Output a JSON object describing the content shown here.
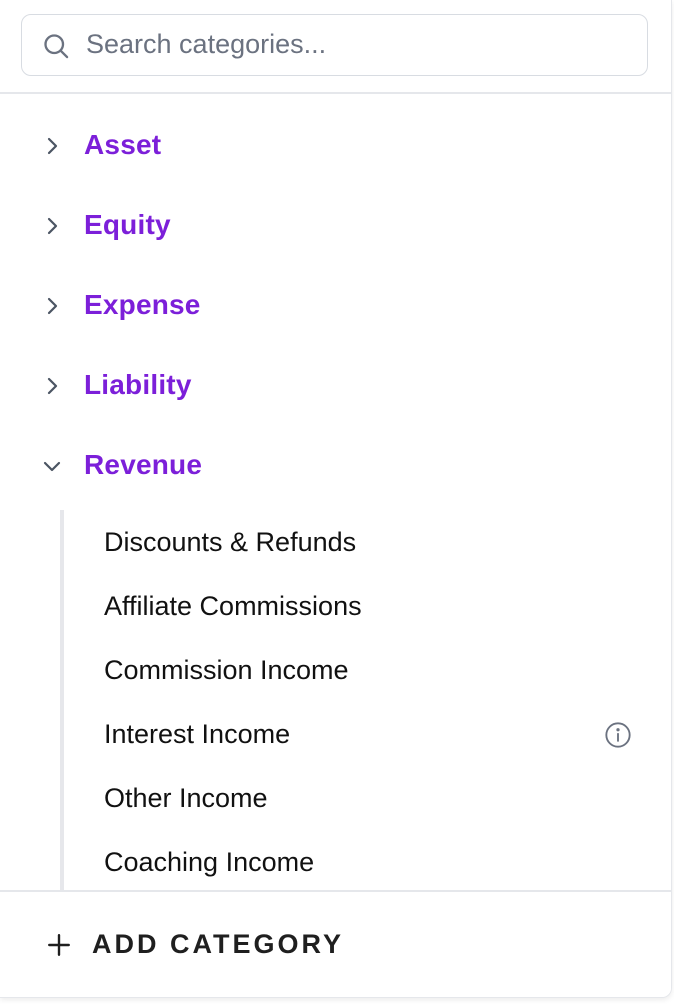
{
  "search": {
    "placeholder": "Search categories..."
  },
  "groups": [
    {
      "label": "Asset",
      "expanded": false,
      "icon": "chevron-right-icon"
    },
    {
      "label": "Equity",
      "expanded": false,
      "icon": "chevron-right-icon"
    },
    {
      "label": "Expense",
      "expanded": false,
      "icon": "chevron-right-icon"
    },
    {
      "label": "Liability",
      "expanded": false,
      "icon": "chevron-right-icon"
    },
    {
      "label": "Revenue",
      "expanded": true,
      "icon": "chevron-down-icon",
      "items": [
        {
          "label": "Discounts & Refunds"
        },
        {
          "label": "Affiliate Commissions"
        },
        {
          "label": "Commission Income"
        },
        {
          "label": "Interest Income",
          "icon": "info-icon"
        },
        {
          "label": "Other Income"
        },
        {
          "label": "Coaching Income"
        }
      ]
    }
  ],
  "footer": {
    "add_label": "ADD CATEGORY",
    "icon": "plus-icon"
  },
  "colors": {
    "group_label": "#7c1fd9",
    "text": "#111111",
    "muted": "#6b7280",
    "border": "#e5e7eb"
  }
}
